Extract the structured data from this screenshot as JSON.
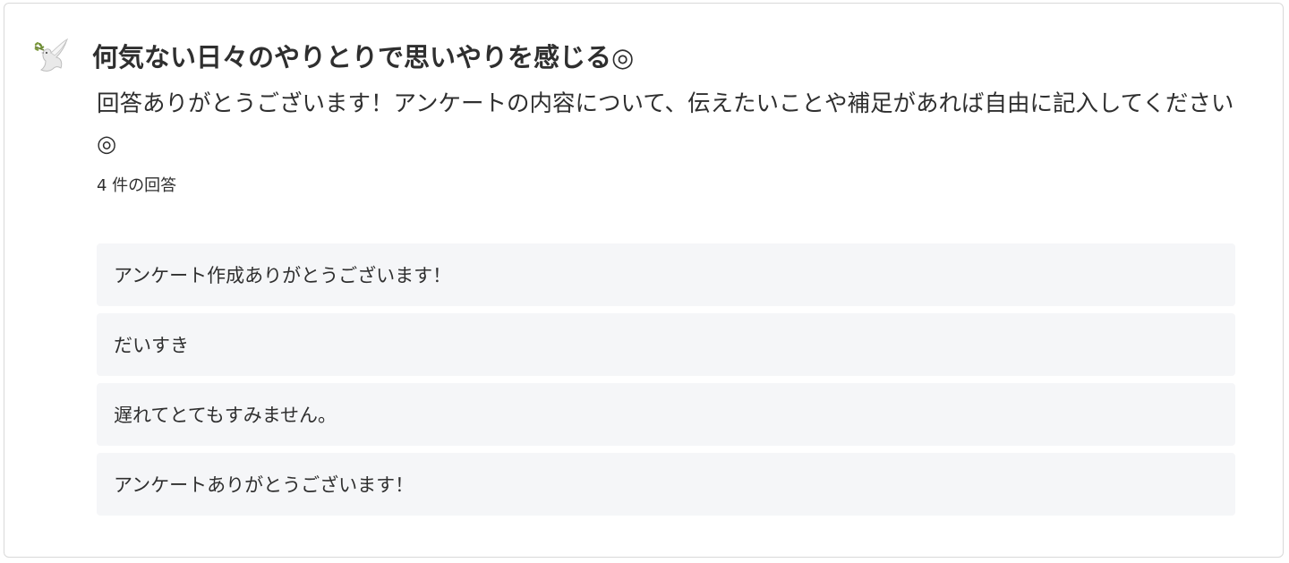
{
  "question": {
    "icon": "dove-with-olive-branch-icon",
    "title": "何気ない日々のやりとりで思いやりを感じる◎",
    "description": "回答ありがとうございます！アンケートの内容について、伝えたいことや補足があれば自由に記入してください◎",
    "response_count": "4 件の回答"
  },
  "responses": [
    "アンケート作成ありがとうございます！",
    "だいすき",
    "遅れてとてもすみません。",
    "アンケートありがとうございます！"
  ]
}
